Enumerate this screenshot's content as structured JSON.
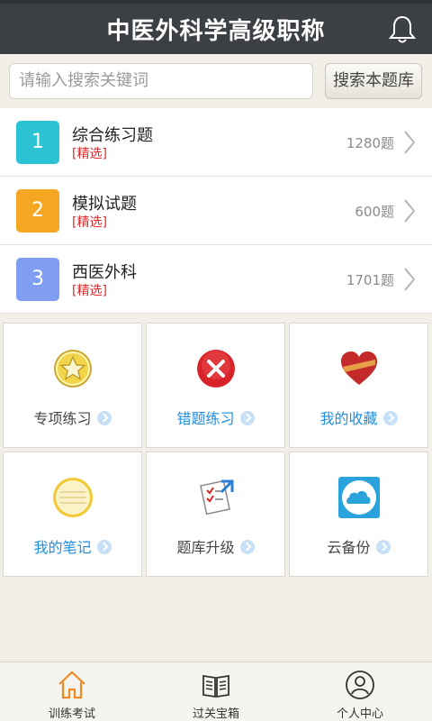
{
  "header": {
    "title": "中医外科学高级职称"
  },
  "search": {
    "placeholder": "请输入搜索关键词",
    "button_label": "搜索本题库"
  },
  "categories": [
    {
      "index": "1",
      "name": "综合练习题",
      "tag": "[精选]",
      "count": "1280题",
      "color": "#2bc2d4"
    },
    {
      "index": "2",
      "name": "模拟试题",
      "tag": "[精选]",
      "count": "600题",
      "color": "#f5a623"
    },
    {
      "index": "3",
      "name": "西医外科",
      "tag": "[精选]",
      "count": "1701题",
      "color": "#7f9ef2"
    }
  ],
  "features": [
    {
      "label": "专项练习",
      "icon": "star-badge-icon"
    },
    {
      "label": "错题练习",
      "icon": "error-x-icon"
    },
    {
      "label": "我的收藏",
      "icon": "heart-icon"
    },
    {
      "label": "我的笔记",
      "icon": "notepad-icon"
    },
    {
      "label": "题库升级",
      "icon": "upgrade-checklist-icon"
    },
    {
      "label": "云备份",
      "icon": "cloud-backup-icon"
    }
  ],
  "tabs": [
    {
      "label": "训练考试",
      "icon": "home-icon",
      "active": true
    },
    {
      "label": "过关宝箱",
      "icon": "book-icon",
      "active": false
    },
    {
      "label": "个人中心",
      "icon": "user-icon",
      "active": false
    }
  ],
  "colors": {
    "header_bg": "#3c3f44",
    "accent_blue": "#1d8fe0",
    "tag_red": "#e02b2b",
    "active_tab": "#f08a24"
  }
}
